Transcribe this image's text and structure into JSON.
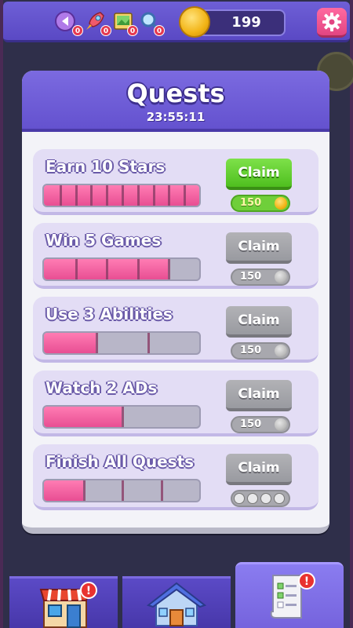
{
  "topbar": {
    "powerups": [
      {
        "icon": "back-arrow-icon",
        "count": "0"
      },
      {
        "icon": "rocket-icon",
        "count": "0"
      },
      {
        "icon": "picture-icon",
        "count": "0"
      },
      {
        "icon": "magnifier-icon",
        "count": "0"
      }
    ],
    "coins": "199"
  },
  "panel": {
    "title": "Quests",
    "timer": "23:55:11"
  },
  "quests": [
    {
      "name": "Earn 10 Stars",
      "progress": 1.0,
      "segments": 10,
      "claim": "Claim",
      "claimable": true,
      "reward": "150"
    },
    {
      "name": "Win 5 Games",
      "progress": 0.8,
      "segments": 5,
      "claim": "Claim",
      "claimable": false,
      "reward": "150"
    },
    {
      "name": "Use 3 Abilities",
      "progress": 0.333,
      "segments": 3,
      "claim": "Claim",
      "claimable": false,
      "reward": "150"
    },
    {
      "name": "Watch 2 ADs",
      "progress": 0.5,
      "segments": 2,
      "claim": "Claim",
      "claimable": false,
      "reward": "150"
    },
    {
      "name": "Finish All Quests",
      "progress": 0.25,
      "segments": 4,
      "claim": "Claim",
      "claimable": false,
      "reward_icons": [
        "back-arrow-icon",
        "rocket-icon",
        "picture-icon",
        "magnifier-icon"
      ]
    }
  ],
  "nav": {
    "tabs": [
      {
        "icon": "shop-icon",
        "badge": "!",
        "active": false
      },
      {
        "icon": "house-icon",
        "badge": "",
        "active": false
      },
      {
        "icon": "quest-scroll-icon",
        "badge": "!",
        "active": true
      }
    ]
  },
  "colors": {
    "accent_purple": "#6e5fd6",
    "progress_pink": "#e84e93",
    "claim_green": "#4fbf1f",
    "claim_disabled": "#999aa0",
    "coin_gold": "#f2b416"
  }
}
